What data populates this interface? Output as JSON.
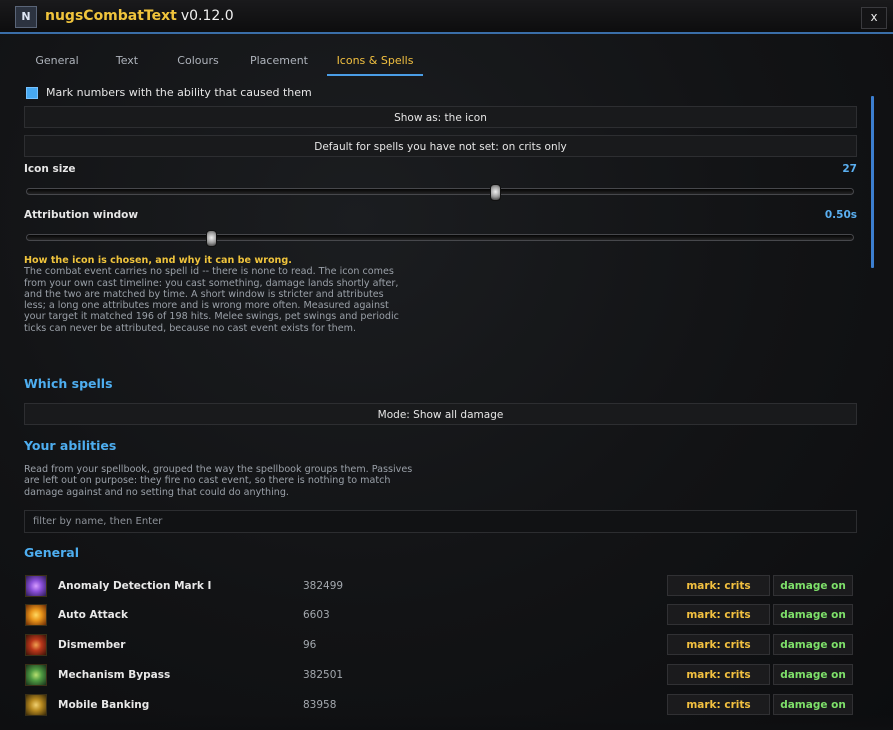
{
  "window": {
    "title": "nugsCombatText",
    "version": "v0.12.0",
    "close_label": "x",
    "icon_glyph": "N"
  },
  "tabs": [
    {
      "label": "General",
      "active": false
    },
    {
      "label": "Text",
      "active": false
    },
    {
      "label": "Colours",
      "active": false
    },
    {
      "label": "Placement",
      "active": false
    },
    {
      "label": "Icons & Spells",
      "active": true
    }
  ],
  "options": {
    "mark_numbers": {
      "label": "Mark numbers with the ability that caused them",
      "checked": true
    },
    "show_as_button": "Show as: the icon",
    "default_button": "Default for spells you have not set: on crits only"
  },
  "sliders": {
    "icon_size": {
      "label": "Icon size",
      "value_text": "27",
      "fraction": 0.565
    },
    "attribution_window": {
      "label": "Attribution window",
      "value_text": "0.50s",
      "fraction": 0.222
    }
  },
  "note": {
    "title": "How the icon is chosen, and why it can be wrong.",
    "body": "The combat event carries no spell id -- there is none to read. The icon comes from your own cast timeline: you cast something, damage lands shortly after, and the two are matched by time. A short window is stricter and attributes less; a long one attributes more and is wrong more often. Measured against your target it matched 196 of 198 hits. Melee swings, pet swings and periodic ticks can never be attributed, because no cast event exists for them."
  },
  "which_spells": {
    "heading": "Which spells",
    "mode_button": "Mode: Show all damage"
  },
  "abilities": {
    "heading": "Your abilities",
    "description": "Read from your spellbook, grouped the way the spellbook groups them. Passives are left out on purpose: they fire no cast event, so there is nothing to match damage against and no setting that could do anything.",
    "filter_placeholder": "filter by name, then Enter",
    "group_heading": "General",
    "rows": [
      {
        "name": "Anomaly Detection Mark I",
        "id": "382499",
        "mark": "mark: crits",
        "damage": "damage on",
        "icon": "anomaly-detection-icon",
        "icon_colors": [
          "#2a1b52",
          "#8a4fd8",
          "#d69cff"
        ]
      },
      {
        "name": "Auto Attack",
        "id": "6603",
        "mark": "mark: crits",
        "damage": "damage on",
        "icon": "auto-attack-icon",
        "icon_colors": [
          "#6b2a05",
          "#e8941a",
          "#ffd860"
        ]
      },
      {
        "name": "Dismember",
        "id": "96",
        "mark": "mark: crits",
        "damage": "damage on",
        "icon": "dismember-icon",
        "icon_colors": [
          "#3a1208",
          "#b8361a",
          "#f0a050"
        ]
      },
      {
        "name": "Mechanism Bypass",
        "id": "382501",
        "mark": "mark: crits",
        "damage": "damage on",
        "icon": "mechanism-bypass-icon",
        "icon_colors": [
          "#17301a",
          "#4f9a42",
          "#b8e070"
        ]
      },
      {
        "name": "Mobile Banking",
        "id": "83958",
        "mark": "mark: crits",
        "damage": "damage on",
        "icon": "mobile-banking-icon",
        "icon_colors": [
          "#3a2a08",
          "#b88a20",
          "#f0d070"
        ]
      }
    ]
  },
  "colors": {
    "accent": "#4eaef0",
    "gold": "#f0c43c",
    "green": "#7ee06a",
    "tab_underline": "#4a9de6"
  }
}
